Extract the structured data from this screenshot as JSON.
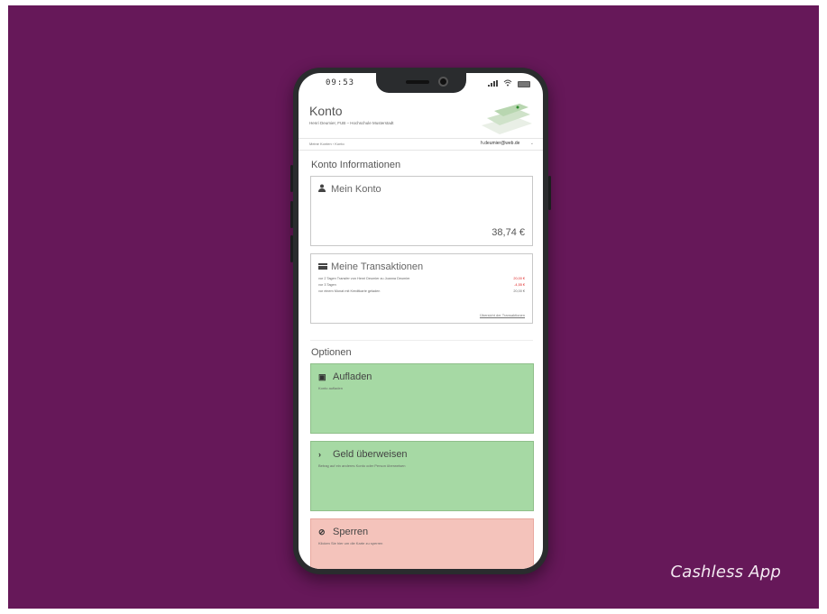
{
  "caption": "Cashless App",
  "status_bar": {
    "time": "09:53",
    "signal_icon": "signal-icon",
    "wifi_icon": "wifi-icon",
    "battery_icon": "battery-icon"
  },
  "header": {
    "title": "Konto",
    "subtitle": "Henri Deumier, FUB – Hochschule Musterstadt"
  },
  "breadcrumb": {
    "text": "Meine Konten › Konto",
    "user_email": "h.deumier@web.de",
    "caret": "⌄"
  },
  "account_section": {
    "title": "Konto Informationen",
    "card_title": "Mein Konto",
    "card_icon": "user-icon",
    "balance": "38,74 €"
  },
  "transactions": {
    "title": "Meine Transaktionen",
    "icon": "credit-card-icon",
    "rows": [
      {
        "text": "vor 2 Tagen Transfer von Henri Deumier zu Joanna Deumier",
        "amount": "20,00 €",
        "negative": true
      },
      {
        "text": "vor 3 Tagen",
        "amount": "-4,55 €",
        "negative": true
      },
      {
        "text": "vor einem Monat mit Kreditkarte geladen",
        "amount": "20,00 €",
        "negative": false
      }
    ],
    "link": "Übersicht der Transaktionen"
  },
  "options": {
    "title": "Optionen",
    "items": [
      {
        "label": "Aufladen",
        "description": "Konto aufladen",
        "icon": "money-icon",
        "icon_glyph": "▣",
        "color": "#a6d9a4"
      },
      {
        "label": "Geld überweisen",
        "description": "Betrag auf ein anderes Konto oder Person überweisen",
        "icon": "chevron-right-icon",
        "icon_glyph": "›",
        "color": "#a6d9a4"
      },
      {
        "label": "Sperren",
        "description": "Klicken Sie hier um die Karte zu sperren",
        "icon": "ban-icon",
        "icon_glyph": "⊘",
        "color": "#f4c3bb"
      }
    ]
  },
  "colors": {
    "background": "#661859",
    "option_green": "#a6d9a4",
    "option_red": "#f4c3bb",
    "negative_amount": "#dd2222"
  }
}
